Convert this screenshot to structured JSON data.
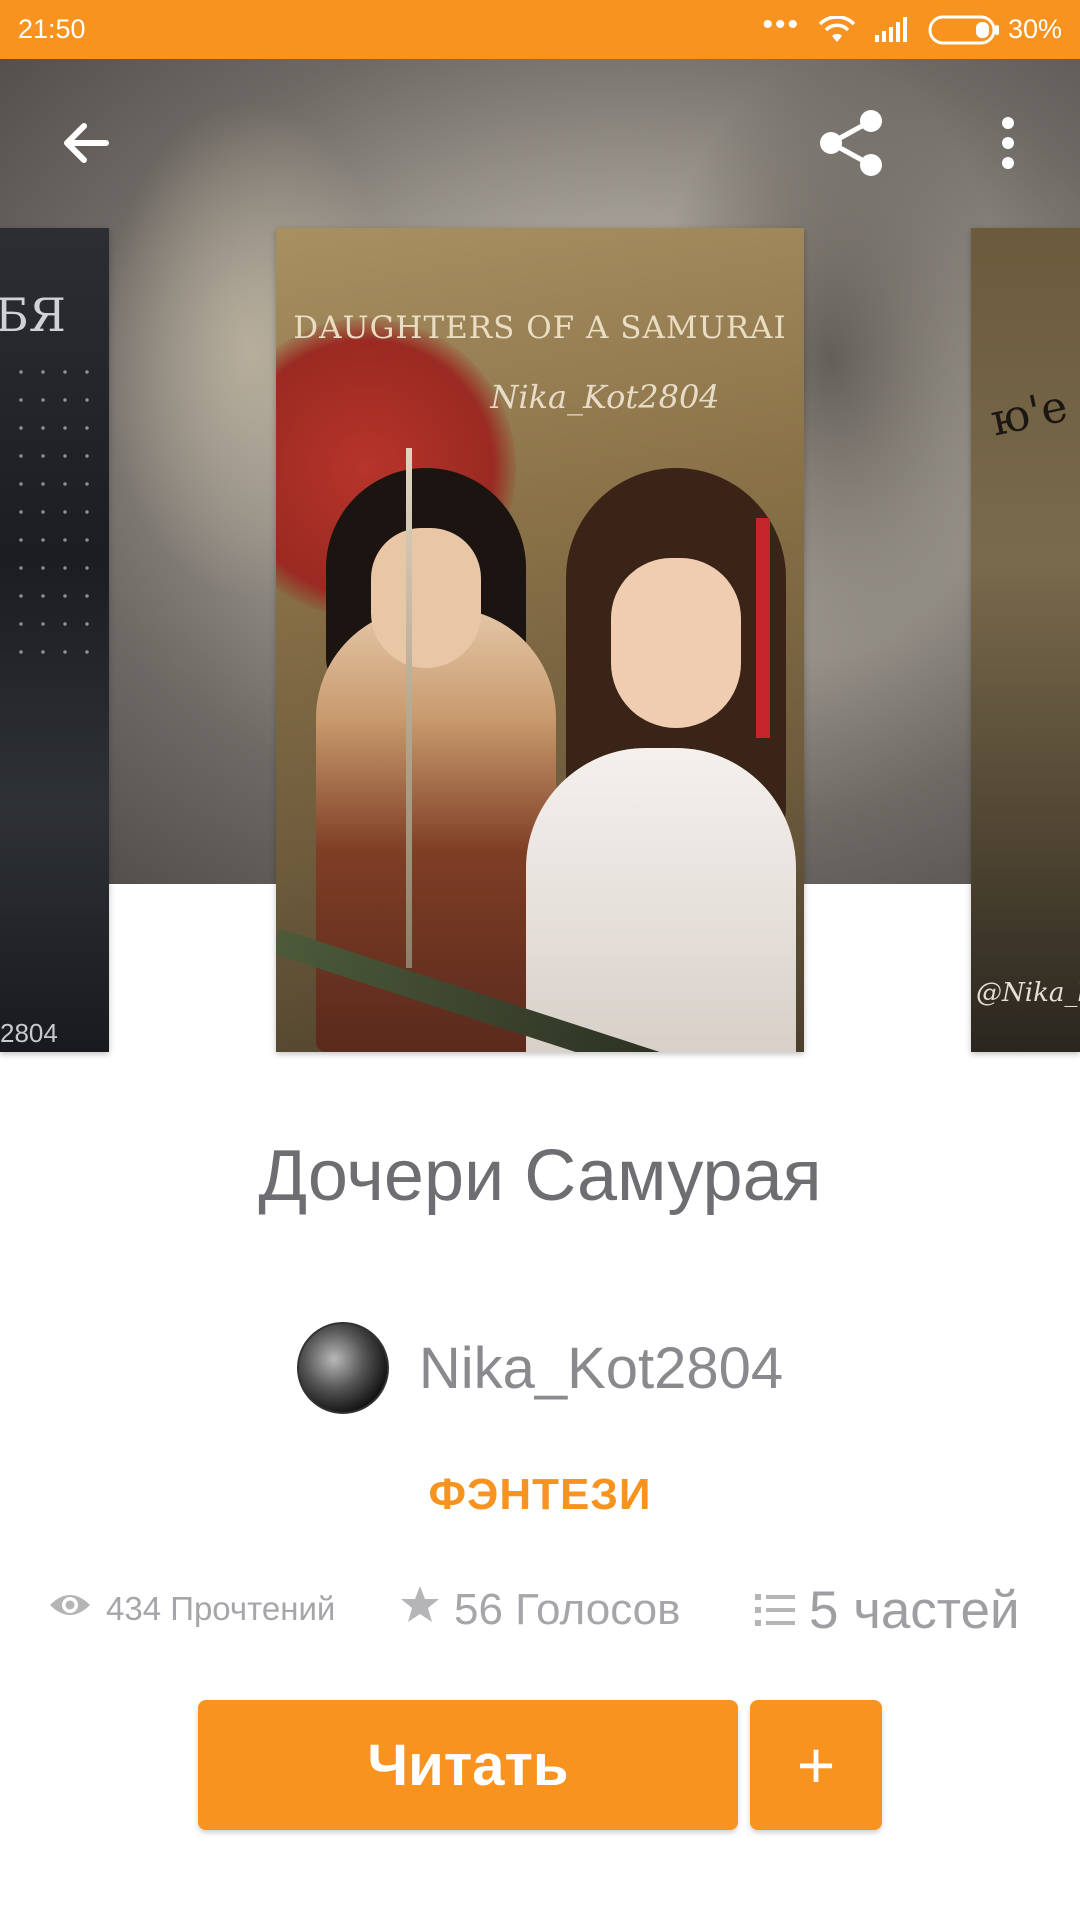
{
  "status_bar": {
    "time": "21:50",
    "dots": "•••",
    "battery": "30%"
  },
  "toolbar": {
    "back_icon": "arrow-left-icon",
    "share_icon": "share-icon",
    "more_icon": "more-vertical-icon"
  },
  "covers": {
    "left": {
      "text": "БЯ",
      "number": "2804"
    },
    "main": {
      "title": "DAUGHTERS OF A SAMURAI",
      "author": "Nika_Kot2804"
    },
    "right": {
      "text": "ю'е",
      "signature": "@Nika_k"
    }
  },
  "book": {
    "title": "Дочери Самурая",
    "author": "Nika_Kot2804",
    "genre": "ФЭНТЕЗИ"
  },
  "stats": {
    "reads": "434 Прочтений",
    "votes": "56 Голосов",
    "parts": "5 частей"
  },
  "actions": {
    "read_label": "Читать",
    "add_label": "+"
  },
  "colors": {
    "accent": "#f7931e",
    "title_text": "#6e6e72",
    "stat_text": "#a6a6aa"
  }
}
